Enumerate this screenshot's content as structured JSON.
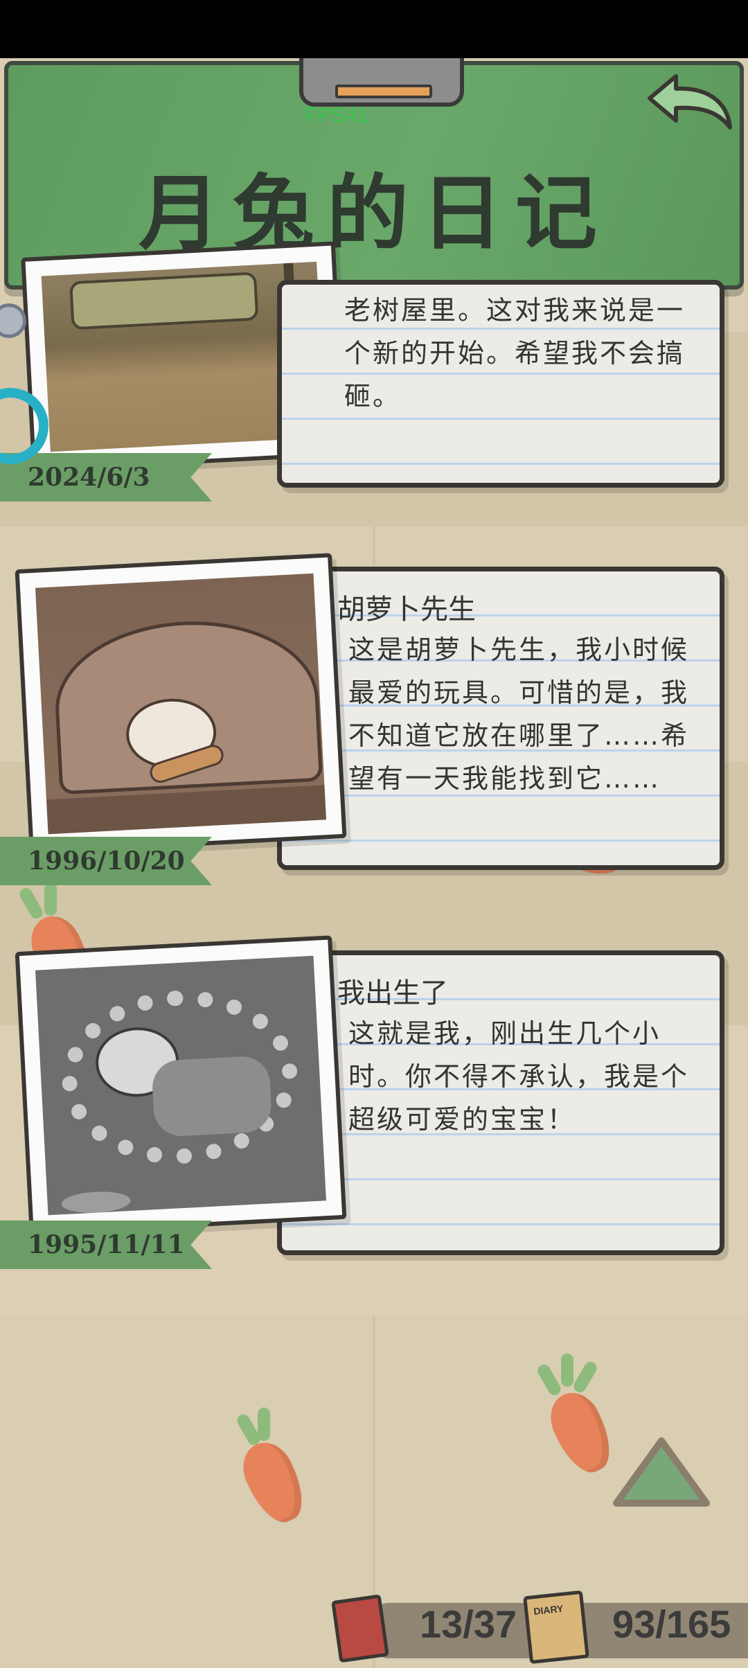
{
  "header": {
    "title": "月兔的日记",
    "fps": "FPS41"
  },
  "entries": [
    {
      "title": "",
      "text": "老树屋里。这对我来说是一个新的开始。希望我不会搞砸。",
      "date": "2024/6/3"
    },
    {
      "title": "胡萝卜先生",
      "text": "这是胡萝卜先生，我小时候最爱的玩具。可惜的是，我不知道它放在哪里了……希望有一天我能找到它……",
      "date": "1996/10/20"
    },
    {
      "title": "我出生了",
      "text": "这就是我，刚出生几个小时。你不得不承认，我是个超级可爱的宝宝！",
      "date": "1995/11/11"
    }
  ],
  "footer": {
    "book_count": "13/37",
    "diary_count": "93/165",
    "diary_label": "DIARY"
  },
  "colors": {
    "header_green": "#6aa86a",
    "ribbon_green": "#6b9e66",
    "background": "#d9cdb2",
    "carrot_orange": "#e6835a"
  }
}
